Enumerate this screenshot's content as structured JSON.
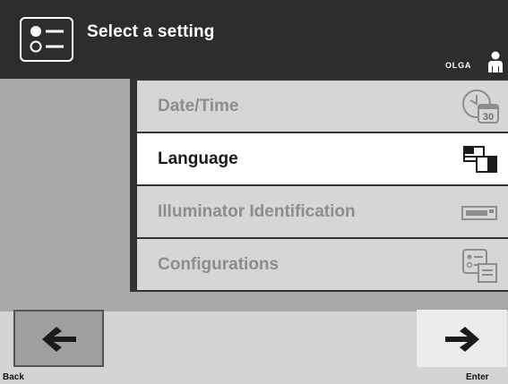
{
  "header": {
    "title": "Select a setting",
    "user": "OLGA",
    "icon": "settings-list-icon"
  },
  "menu": {
    "items": [
      {
        "label": "Date/Time",
        "icon": "clock-calendar-icon",
        "day": "30",
        "enabled": false,
        "selected": false
      },
      {
        "label": "Language",
        "icon": "flags-icon",
        "enabled": true,
        "selected": true
      },
      {
        "label": "Illuminator Identification",
        "icon": "illuminator-icon",
        "enabled": false,
        "selected": false
      },
      {
        "label": "Configurations",
        "icon": "configurations-icon",
        "enabled": false,
        "selected": false
      }
    ]
  },
  "nav": {
    "back_label": "Back",
    "enter_label": "Enter"
  },
  "colors": {
    "header_bg": "#2d2d2d",
    "content_bg": "#a9a9a9",
    "item_disabled_bg": "#d6d6d6",
    "item_selected_bg": "#ffffff"
  }
}
